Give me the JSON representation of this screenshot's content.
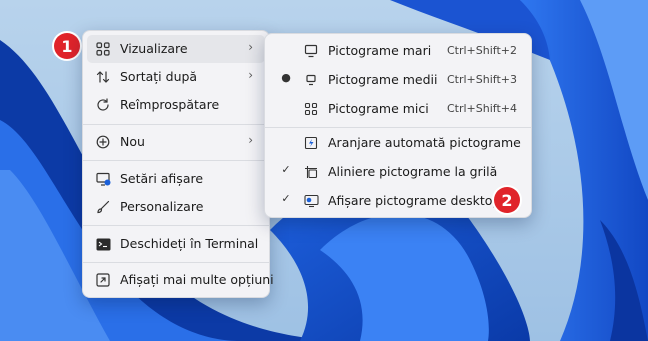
{
  "main_menu": {
    "items": [
      {
        "label": "Vizualizare",
        "icon": "grid-view-icon",
        "has_submenu": true
      },
      {
        "label": "Sortați după",
        "icon": "sort-arrows-icon",
        "has_submenu": true
      },
      {
        "label": "Reîmprospătare",
        "icon": "refresh-icon"
      },
      {
        "label": "Nou",
        "icon": "plus-circle-icon",
        "has_submenu": true
      },
      {
        "label": "Setări afișare",
        "icon": "display-settings-icon"
      },
      {
        "label": "Personalizare",
        "icon": "brush-icon"
      },
      {
        "label": "Deschideți în Terminal",
        "icon": "terminal-icon"
      },
      {
        "label": "Afișați mai multe opțiuni",
        "icon": "more-options-icon"
      }
    ],
    "arrow": "›"
  },
  "sub_menu": {
    "items": [
      {
        "label": "Pictograme mari",
        "shortcut": "Ctrl+Shift+2",
        "icon": "monitor-icon",
        "mark": ""
      },
      {
        "label": "Pictograme medii",
        "shortcut": "Ctrl+Shift+3",
        "icon": "monitor-small-icon",
        "mark": "●"
      },
      {
        "label": "Pictograme mici",
        "shortcut": "Ctrl+Shift+4",
        "icon": "small-grid-icon",
        "mark": ""
      },
      {
        "label": "Aranjare automată pictograme",
        "shortcut": "",
        "icon": "auto-arrange-icon",
        "mark": ""
      },
      {
        "label": "Aliniere pictograme la grilă",
        "shortcut": "",
        "icon": "grid-align-icon",
        "mark": "✓"
      },
      {
        "label": "Afișare pictograme desktop",
        "shortcut": "",
        "icon": "desktop-icons-icon",
        "mark": "✓"
      }
    ]
  },
  "badges": {
    "first": "1",
    "second": "2"
  },
  "colors": {
    "accent": "#1a5fd8",
    "badge": "#e0242a",
    "menu_bg": "#f3f3f6"
  }
}
